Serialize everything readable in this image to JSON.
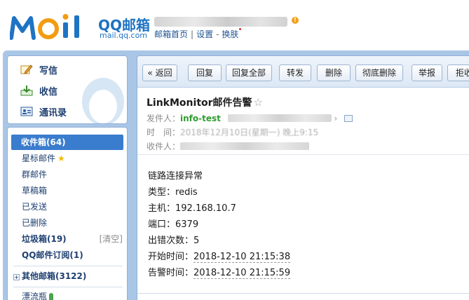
{
  "header": {
    "logo_main": "QQ邮箱",
    "logo_sub": "mail.qq.com",
    "alert_badge": "!",
    "links": [
      "邮箱首页",
      "设置",
      "换肤"
    ],
    "link_separators": [
      "|",
      "-"
    ]
  },
  "quick_actions": [
    {
      "label": "写信",
      "icon": "write-icon"
    },
    {
      "label": "收信",
      "icon": "receive-icon"
    },
    {
      "label": "通讯录",
      "icon": "contacts-icon"
    }
  ],
  "folders": {
    "inbox": "收件箱(64)",
    "starred": "星标邮件",
    "starred_icon": "★",
    "group": "群邮件",
    "drafts": "草稿箱",
    "sent": "已发送",
    "deleted": "已删除",
    "spam": "垃圾箱(19)",
    "spam_clear": "[清空]",
    "subscriptions": "QQ邮件订阅(1)",
    "other_expander": "+",
    "other": "其他邮箱(3122)",
    "drift_bottle": "漂流瓶"
  },
  "toolbar": {
    "back": "« 返回",
    "reply": "回复",
    "reply_all": "回复全部",
    "forward": "转发",
    "delete": "删除",
    "delete_forever": "彻底删除",
    "report": "举报",
    "reject": "拒收"
  },
  "mail": {
    "subject": "LinkMonitor邮件告警",
    "star_glyph": "☆",
    "from_label": "发件人：",
    "from_name": "info-test",
    "from_arrow": "›",
    "time_label": "时　间：",
    "time_value": "2018年12月10日(星期一) 晚上9:15",
    "to_label": "收件人："
  },
  "body": {
    "heading": "链路连接异常",
    "type_label": "类型：",
    "type_value": "redis",
    "host_label": "主机：",
    "host_value": "192.168.10.7",
    "port_label": "端口：",
    "port_value": "6379",
    "errors_label": "出错次数：",
    "errors_value": "5",
    "start_label": "开始时间：",
    "start_value": "2018-12-10 21:15:38",
    "alert_label": "告警时间：",
    "alert_value": "2018-12-10 21:15:59"
  },
  "colors": {
    "brand_blue": "#1f73c3",
    "brand_orange": "#f39c12",
    "selected_folder": "#3a7ccd",
    "sender_green": "#2f9d2f",
    "frame_blue": "#a9c6e6"
  }
}
